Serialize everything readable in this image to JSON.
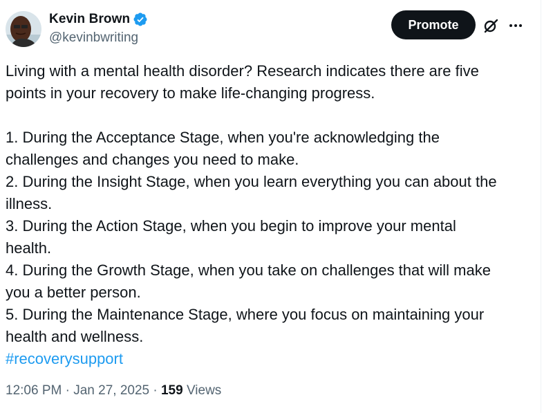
{
  "author": {
    "display_name": "Kevin Brown",
    "handle": "@kevinbwriting",
    "verified_icon": "verified-badge-icon",
    "verified_color": "#1d9bf0"
  },
  "actions": {
    "promote_label": "Promote",
    "grok_icon": "grok-icon",
    "more_icon": "more-icon"
  },
  "post": {
    "lines": [
      "Living with a mental health disorder? Research indicates there are five",
      "points in your recovery to make life-changing progress.",
      "",
      "1. During the Acceptance Stage, when you're acknowledging the",
      "challenges and changes you need to make.",
      "2. During the Insight Stage, when you learn everything you can about the",
      "illness.",
      "3. During the Action Stage, when you begin to improve your mental",
      "health.",
      "4. During the Growth Stage, when you take on challenges that will make",
      "you a better person.",
      "5. During the Maintenance Stage, where you focus on maintaining your",
      "health and wellness."
    ],
    "hashtag": "#recoverysupport",
    "hashtag_color": "#1d9bf0"
  },
  "meta": {
    "time": "12:06 PM",
    "separator": " · ",
    "date": "Jan 27, 2025",
    "views_count": "159",
    "views_label": "Views"
  },
  "colors": {
    "text": "#0f1419",
    "secondary": "#536471",
    "button_bg": "#0f1419"
  }
}
